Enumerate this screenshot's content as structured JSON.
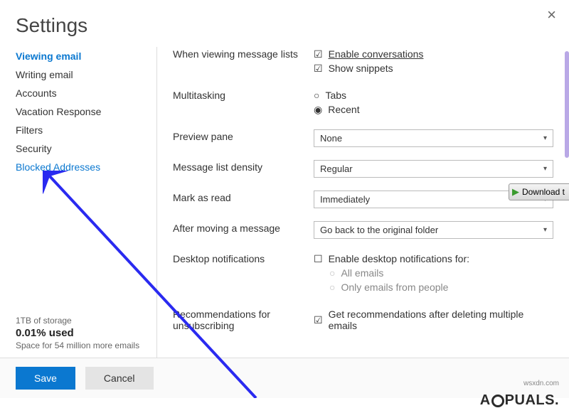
{
  "title": "Settings",
  "close_glyph": "×",
  "sidebar": {
    "items": [
      {
        "label": "Viewing email",
        "active": true
      },
      {
        "label": "Writing email"
      },
      {
        "label": "Accounts"
      },
      {
        "label": "Vacation Response"
      },
      {
        "label": "Filters"
      },
      {
        "label": "Security"
      },
      {
        "label": "Blocked Addresses",
        "linklike": true
      }
    ]
  },
  "storage": {
    "line1": "1TB of storage",
    "used": "0.01% used",
    "line2": "Space for 54 million more emails"
  },
  "settings": {
    "viewing_lists": {
      "label": "When viewing message lists",
      "opt1": {
        "text": "Enable conversations",
        "checked": true
      },
      "opt2": {
        "text": "Show snippets",
        "checked": true
      }
    },
    "multitasking": {
      "label": "Multitasking",
      "opt1": {
        "text": "Tabs",
        "selected": false
      },
      "opt2": {
        "text": "Recent",
        "selected": true
      }
    },
    "preview_pane": {
      "label": "Preview pane",
      "value": "None"
    },
    "density": {
      "label": "Message list density",
      "value": "Regular"
    },
    "mark_read": {
      "label": "Mark as read",
      "value": "Immediately"
    },
    "after_move": {
      "label": "After moving a message",
      "value": "Go back to the original folder"
    },
    "desktop_notif": {
      "label": "Desktop notifications",
      "main": {
        "text": "Enable desktop notifications for:",
        "checked": false
      },
      "sub1": {
        "text": "All emails"
      },
      "sub2": {
        "text": "Only emails from people"
      }
    },
    "recommendations": {
      "label": "Recommendations for unsubscribing",
      "opt": {
        "text": "Get recommendations after deleting multiple emails",
        "checked": true
      }
    }
  },
  "footer": {
    "save": "Save",
    "cancel": "Cancel"
  },
  "badge": {
    "text": "Download t"
  },
  "watermark1": "wsxdn.com",
  "watermark2_a": "A",
  "watermark2_b": "PUALS.",
  "glyphs": {
    "checked": "☑",
    "unchecked": "☐",
    "radio_on": "◉",
    "radio_off": "○",
    "caret": "▾",
    "play": "▶"
  }
}
